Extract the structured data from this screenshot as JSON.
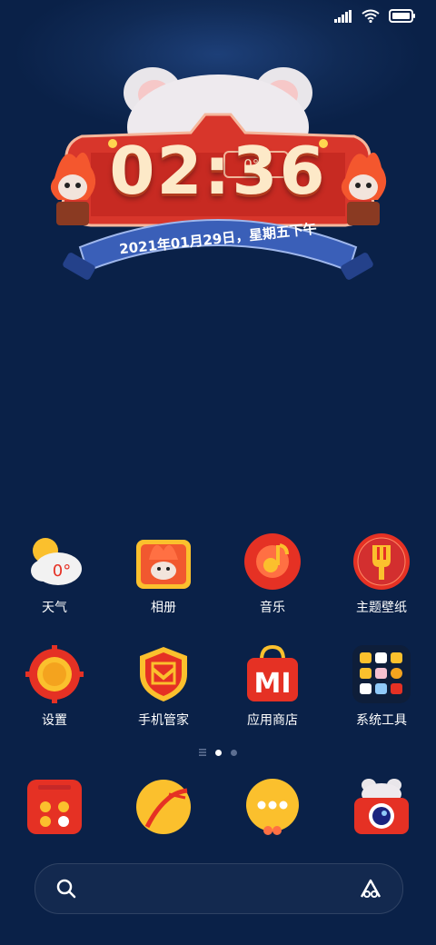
{
  "status_bar": {
    "signal_icon": "signal-icon",
    "wifi_icon": "wifi-icon",
    "battery_icon": "battery-icon"
  },
  "clock_widget": {
    "temperature": "0°C",
    "time": "02:36",
    "date": "2021年01月29日，星期五下午"
  },
  "apps_row1": [
    {
      "label": "天气",
      "icon": "weather-icon"
    },
    {
      "label": "相册",
      "icon": "gallery-icon"
    },
    {
      "label": "音乐",
      "icon": "music-icon"
    },
    {
      "label": "主题壁纸",
      "icon": "themes-icon"
    }
  ],
  "apps_row2": [
    {
      "label": "设置",
      "icon": "settings-icon"
    },
    {
      "label": "手机管家",
      "icon": "security-icon"
    },
    {
      "label": "应用商店",
      "icon": "app-store-icon"
    },
    {
      "label": "系统工具",
      "icon": "folder-icon"
    }
  ],
  "weather_icon_text": "0°",
  "app_store_icon_text": "MI",
  "dock": [
    {
      "icon": "phone-icon"
    },
    {
      "icon": "browser-icon"
    },
    {
      "icon": "messages-icon"
    },
    {
      "icon": "camera-icon"
    }
  ],
  "page_indicator": {
    "total_pages": 2,
    "current_page": 1
  },
  "search_bar": {
    "search_icon": "search-icon",
    "assistant_icon": "assistant-icon"
  },
  "colors": {
    "background": "#0a2148",
    "accent_red": "#e53124",
    "accent_yellow": "#fbc02d"
  }
}
